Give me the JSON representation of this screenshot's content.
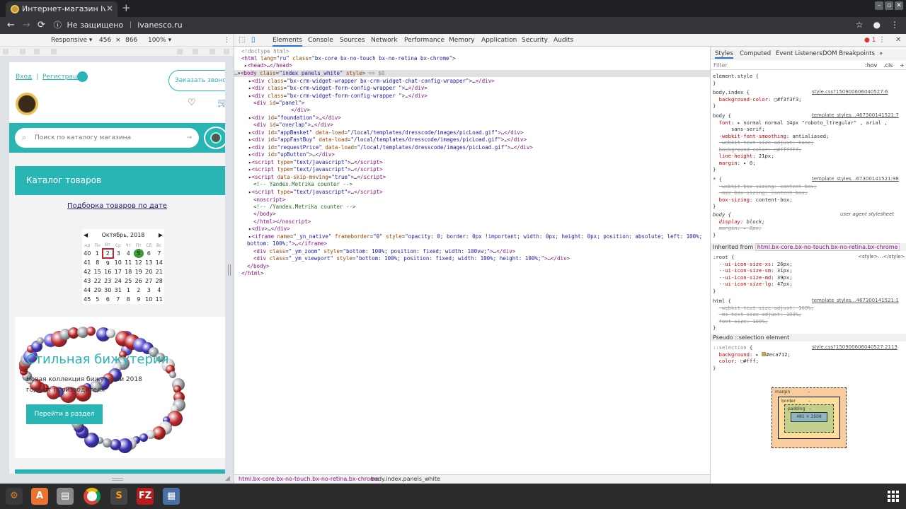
{
  "browser": {
    "tab_title": "Интернет-магазин Ivanesco",
    "tab_close": "✕",
    "new_tab": "+",
    "security_text": "Не защищено",
    "url": "ivanesco.ru",
    "nav_back": "←",
    "nav_forward": "→",
    "nav_reload": "⟳",
    "bookmark_icon": "☆",
    "menu_icon": "⋮"
  },
  "device_toolbar": {
    "mode": "Responsive ▾",
    "width": "456",
    "times": "×",
    "height": "866",
    "zoom": "100% ▾",
    "more": "⋮"
  },
  "site": {
    "login": "Вход",
    "sep": "|",
    "register": "Регистрация",
    "call_button": "Заказать звонок",
    "search_placeholder": "Поиск по каталогу магазина",
    "catalog": "Каталог товаров",
    "dates_link": "Подборка товаров по дате",
    "banner_title": "Стильная бижутерия",
    "banner_sub": "Новая коллекция бижутерии 2018 года от производителя",
    "banner_button": "Перейти в раздел"
  },
  "calendar": {
    "prev": "◀",
    "next": "▶",
    "month": "Октябрь, 2018",
    "headers": [
      "нд",
      "Пн",
      "Вт",
      "Ср",
      "Чт",
      "Пт",
      "Сб",
      "Вс"
    ],
    "rows": [
      [
        "40",
        "1",
        "2",
        "3",
        "4",
        "5",
        "6",
        "7"
      ],
      [
        "41",
        "8",
        "9",
        "10",
        "11",
        "12",
        "13",
        "14"
      ],
      [
        "42",
        "15",
        "16",
        "17",
        "18",
        "19",
        "20",
        "21"
      ],
      [
        "43",
        "22",
        "23",
        "24",
        "25",
        "26",
        "27",
        "28"
      ],
      [
        "44",
        "29",
        "30",
        "31",
        "1",
        "2",
        "3",
        "4"
      ],
      [
        "45",
        "5",
        "6",
        "7",
        "8",
        "9",
        "10",
        "11"
      ]
    ],
    "today": "2",
    "selected": "5"
  },
  "devtools": {
    "tabs": [
      "Elements",
      "Console",
      "Sources",
      "Network",
      "Performance",
      "Memory",
      "Application",
      "Security",
      "Audits"
    ],
    "active_tab": "Elements",
    "error_count": "1",
    "close": "✕",
    "breadcrumbs": [
      "html.bx-core.bx-no-touch.bx-no-retina.bx-chrome",
      "body.index.panels_white"
    ],
    "styles_tabs": [
      "Styles",
      "Computed",
      "Event Listeners",
      "DOM Breakpoints",
      "»"
    ],
    "filter_placeholder": "Filter",
    "hov": ":hov",
    "cls": ".cls",
    "plus": "+",
    "inherited_label": "Inherited from",
    "inherited_from": "html.bx-core.bx-no-touch.bx-no-retina.bx-chrome",
    "pseudo_label": "Pseudo ::selection element",
    "box": {
      "margin": "margin",
      "border": "border",
      "padding": "padding",
      "content": "481 × 3508",
      "dash": "–"
    }
  },
  "colors": {
    "accent": "#29b5b3",
    "devtools_tag": "#881280",
    "devtools_attr": "#994500",
    "devtools_value": "#1a1aa6"
  },
  "taskbar": {
    "apps": [
      "settings-icon",
      "store-icon",
      "files-icon",
      "chrome-icon",
      "sublime-icon",
      "filezilla-icon",
      "taskmanager-icon"
    ],
    "filezilla_label": "FZ"
  }
}
